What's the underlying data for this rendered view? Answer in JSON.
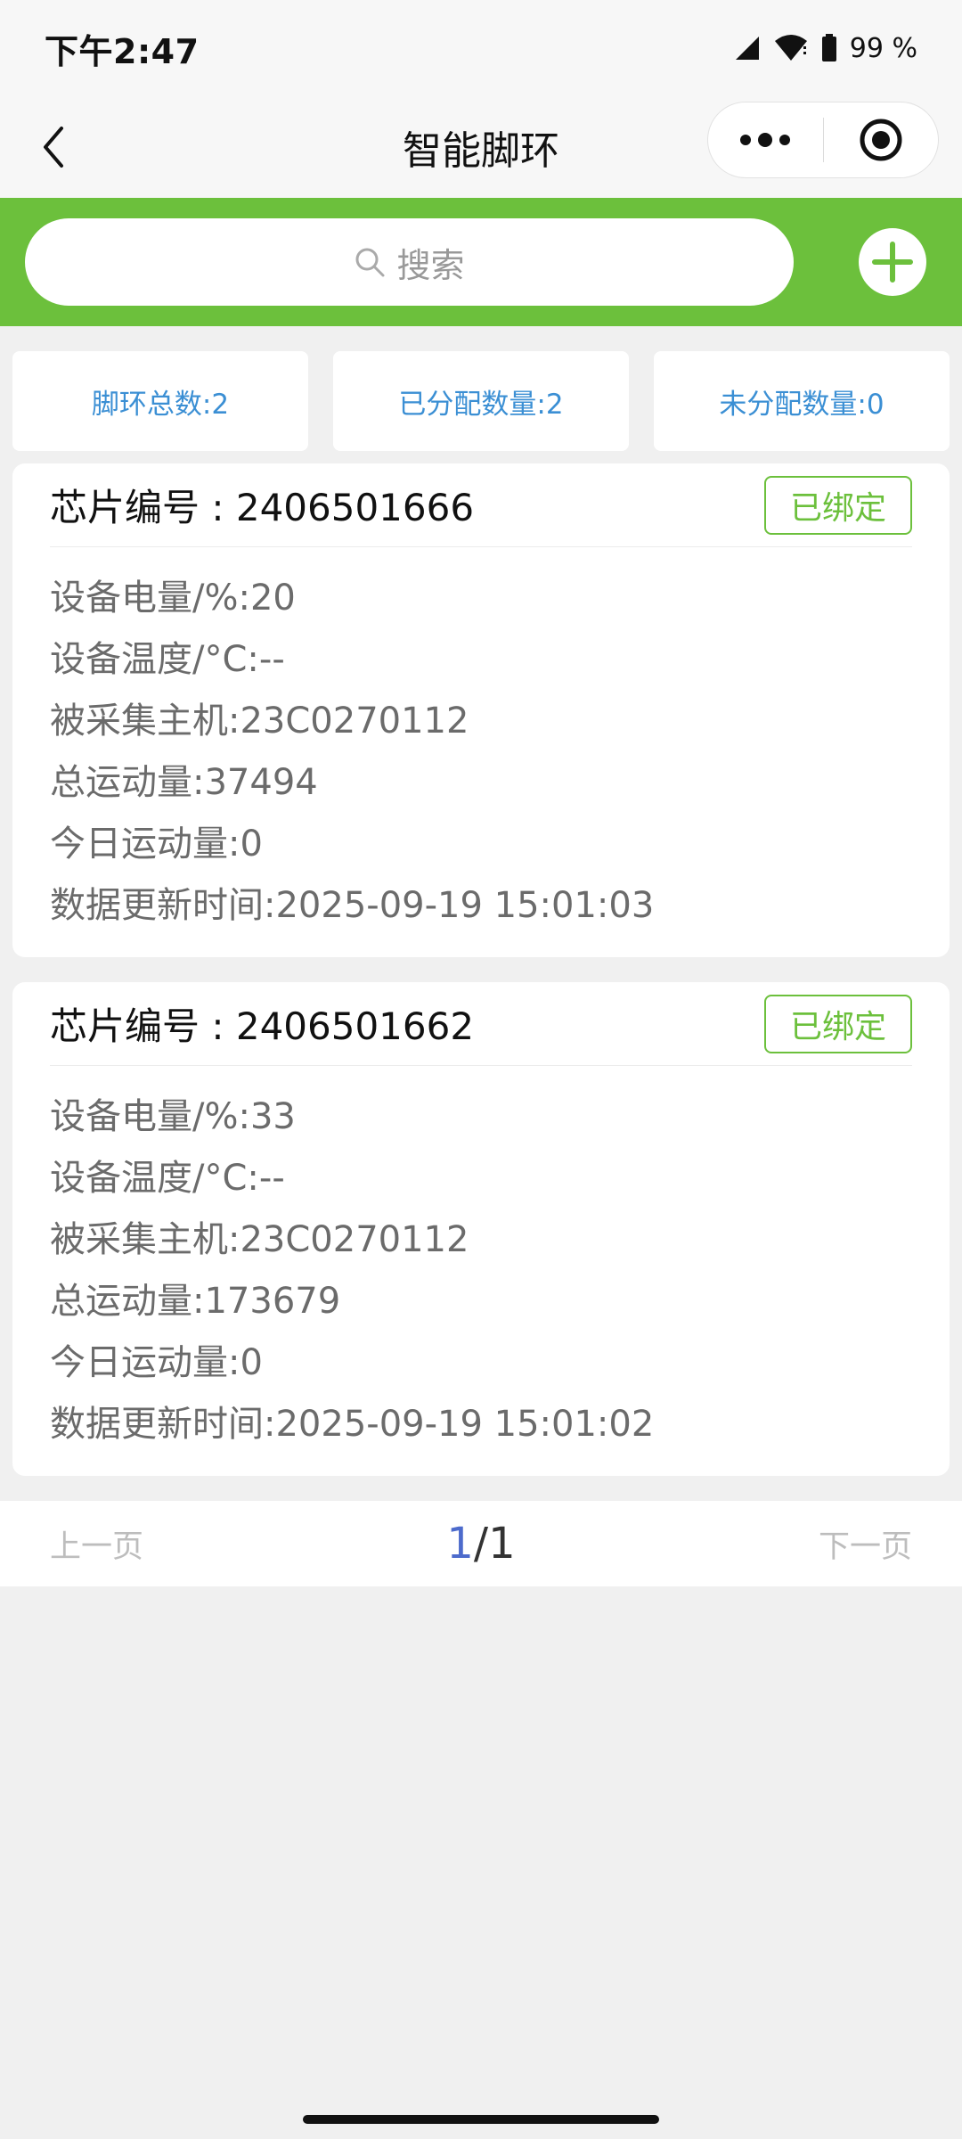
{
  "status_bar": {
    "time": "下午2:47",
    "battery": "99 %"
  },
  "nav": {
    "title": "智能脚环"
  },
  "search": {
    "placeholder": "搜索"
  },
  "stats": [
    {
      "label": "脚环总数:2"
    },
    {
      "label": "已分配数量:2"
    },
    {
      "label": "未分配数量:0"
    }
  ],
  "devices": [
    {
      "chip": "芯片编号 : 2406501666",
      "tag": "已绑定",
      "battery": "设备电量/%:20",
      "temperature": "设备温度/°C:--",
      "host": "被采集主机:23C0270112",
      "total": "总运动量:37494",
      "today": "今日运动量:0",
      "updated": "数据更新时间:2025-09-19 15:01:03"
    },
    {
      "chip": "芯片编号 : 2406501662",
      "tag": "已绑定",
      "battery": "设备电量/%:33",
      "temperature": "设备温度/°C:--",
      "host": "被采集主机:23C0270112",
      "total": "总运动量:173679",
      "today": "今日运动量:0",
      "updated": "数据更新时间:2025-09-19 15:01:02"
    }
  ],
  "pager": {
    "prev": "上一页",
    "current": "1",
    "separator": "/",
    "total": "1",
    "next": "下一页"
  },
  "colors": {
    "accent_green": "#6cc03c",
    "stat_blue": "#3b8fd4",
    "page_blue": "#4d6bcc"
  },
  "icons": [
    "back-arrow-icon",
    "more-dots-icon",
    "target-icon",
    "search-icon",
    "plus-icon",
    "signal-icon",
    "wifi-icon",
    "battery-icon"
  ]
}
